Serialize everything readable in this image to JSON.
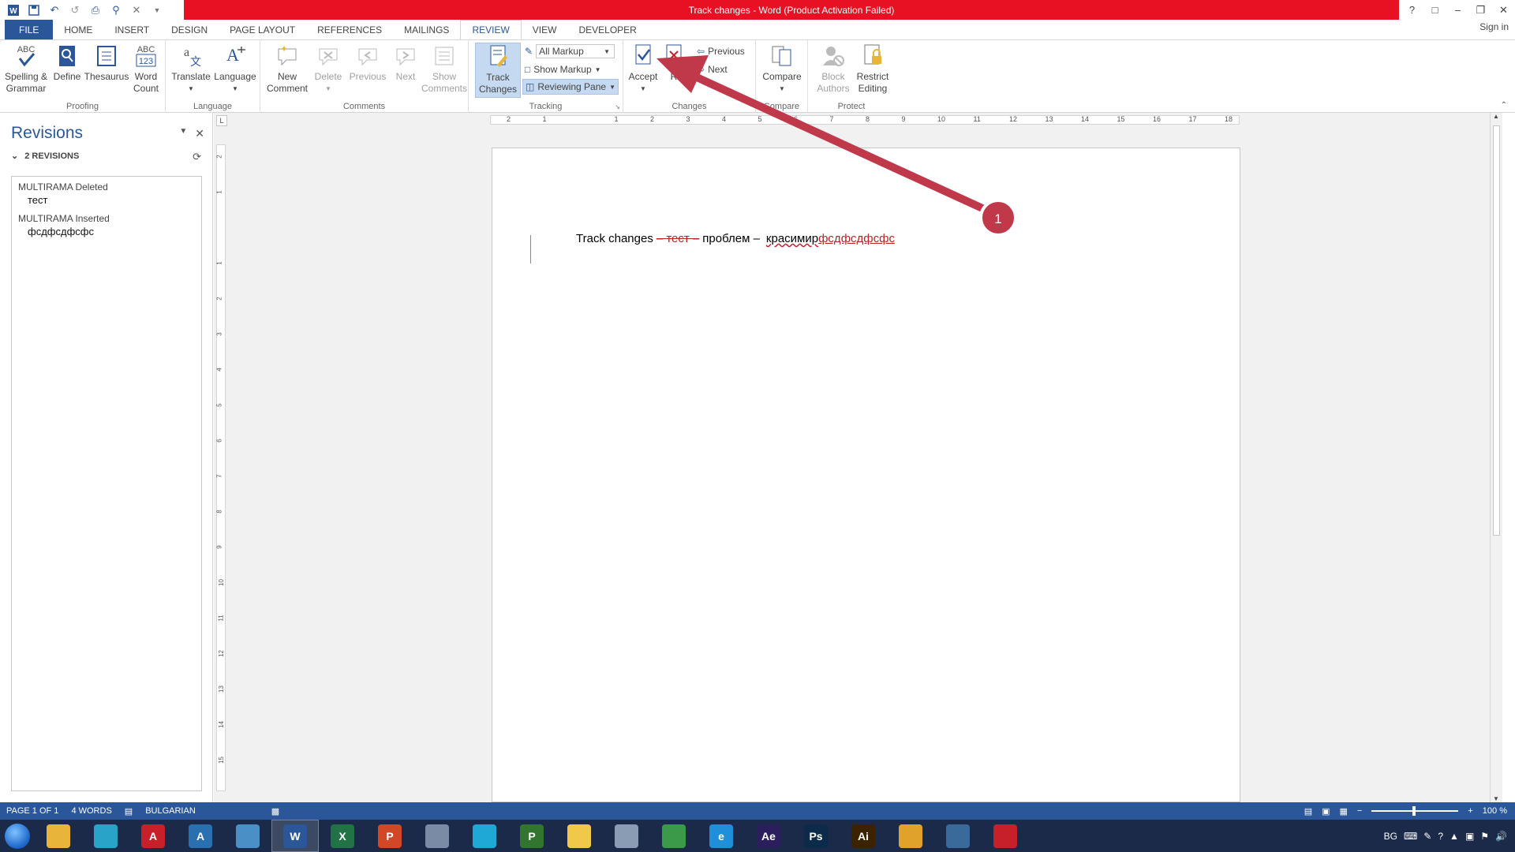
{
  "titlebar": {
    "title": "Track changes -  Word (Product Activation Failed)",
    "help": "?",
    "ribbon_display": "□",
    "minimize": "–",
    "restore": "❐",
    "close": "✕"
  },
  "tabs": [
    {
      "label": "FILE"
    },
    {
      "label": "HOME"
    },
    {
      "label": "INSERT"
    },
    {
      "label": "DESIGN"
    },
    {
      "label": "PAGE LAYOUT"
    },
    {
      "label": "REFERENCES"
    },
    {
      "label": "MAILINGS"
    },
    {
      "label": "REVIEW"
    },
    {
      "label": "VIEW"
    },
    {
      "label": "DEVELOPER"
    }
  ],
  "signin": "Sign in",
  "ribbon": {
    "proofing": {
      "label": "Proofing",
      "spelling": "Spelling &",
      "spelling2": "Grammar",
      "define": "Define",
      "thesaurus": "Thesaurus",
      "wordcount": "Word",
      "wordcount2": "Count"
    },
    "language": {
      "label": "Language",
      "translate": "Translate",
      "language": "Language"
    },
    "comments": {
      "label": "Comments",
      "new": "New",
      "new2": "Comment",
      "delete": "Delete",
      "previous": "Previous",
      "next": "Next",
      "show": "Show",
      "show2": "Comments"
    },
    "tracking": {
      "label": "Tracking",
      "track": "Track",
      "track2": "Changes",
      "markup_select": "All Markup",
      "show_markup": "Show Markup",
      "reviewing_pane": "Reviewing Pane"
    },
    "changes": {
      "label": "Changes",
      "accept": "Accept",
      "reject": "R",
      "previous": "Previous",
      "next": "Next"
    },
    "compare": {
      "label": "Compare",
      "compare": "Compare"
    },
    "protect": {
      "label": "Protect",
      "block": "Block",
      "block2": "Authors",
      "restrict": "Restrict",
      "restrict2": "Editing"
    }
  },
  "revisions": {
    "title": "Revisions",
    "summary": "2 REVISIONS",
    "items": [
      {
        "head": "MULTIRAMA Deleted",
        "text": "тест"
      },
      {
        "head": "MULTIRAMA Inserted",
        "text": "фсдфсдфсфс"
      }
    ]
  },
  "document": {
    "t1": "Track changes",
    "deleted": "– тест –",
    "t2": "проблем –",
    "t3": "красимир",
    "inserted": "фсдфсдфсфс"
  },
  "annotation": {
    "number": "1",
    "color": "#c0394b"
  },
  "ruler": {
    "horizontal": [
      "2",
      "1",
      "",
      "1",
      "2",
      "3",
      "4",
      "5",
      "6",
      "7",
      "8",
      "9",
      "10",
      "11",
      "12",
      "13",
      "14",
      "15",
      "16",
      "17",
      "18"
    ],
    "vertical": [
      "2",
      "1",
      "",
      "1",
      "2",
      "3",
      "4",
      "5",
      "6",
      "7",
      "8",
      "9",
      "10",
      "11",
      "12",
      "13",
      "14",
      "15"
    ]
  },
  "status": {
    "page": "PAGE 1 OF 1",
    "words": "4 WORDS",
    "language": "BULGARIAN",
    "zoom": "100 %"
  },
  "taskbar": {
    "apps": [
      {
        "name": "explorer",
        "label": "",
        "color": "#e8b43a"
      },
      {
        "name": "app2",
        "label": "",
        "color": "#2aa3c9"
      },
      {
        "name": "acrobat-red",
        "label": "A",
        "color": "#c8202b"
      },
      {
        "name": "autocad",
        "label": "A",
        "color": "#2a6fb0"
      },
      {
        "name": "app5",
        "label": "",
        "color": "#4a90c6"
      },
      {
        "name": "word",
        "label": "W",
        "color": "#2b579a"
      },
      {
        "name": "excel",
        "label": "X",
        "color": "#217346"
      },
      {
        "name": "powerpoint",
        "label": "P",
        "color": "#d24726"
      },
      {
        "name": "calculator",
        "label": "",
        "color": "#7a8ba6"
      },
      {
        "name": "app10",
        "label": "",
        "color": "#1fa7d6"
      },
      {
        "name": "project",
        "label": "P",
        "color": "#31752f"
      },
      {
        "name": "folder",
        "label": "",
        "color": "#f0c84a"
      },
      {
        "name": "paint",
        "label": "",
        "color": "#8a9cb3"
      },
      {
        "name": "chrome",
        "label": "",
        "color": "#3a9a4a"
      },
      {
        "name": "ie",
        "label": "e",
        "color": "#1e8fd8"
      },
      {
        "name": "after-effects",
        "label": "Ae",
        "color": "#2a1f5c"
      },
      {
        "name": "photoshop",
        "label": "Ps",
        "color": "#0c2b4a"
      },
      {
        "name": "illustrator",
        "label": "Ai",
        "color": "#3d2200"
      },
      {
        "name": "media",
        "label": "",
        "color": "#e0a22b"
      },
      {
        "name": "chat",
        "label": "",
        "color": "#3a6a9a"
      },
      {
        "name": "acrobat",
        "label": "",
        "color": "#c8202b"
      }
    ],
    "tray_lang": "BG"
  }
}
